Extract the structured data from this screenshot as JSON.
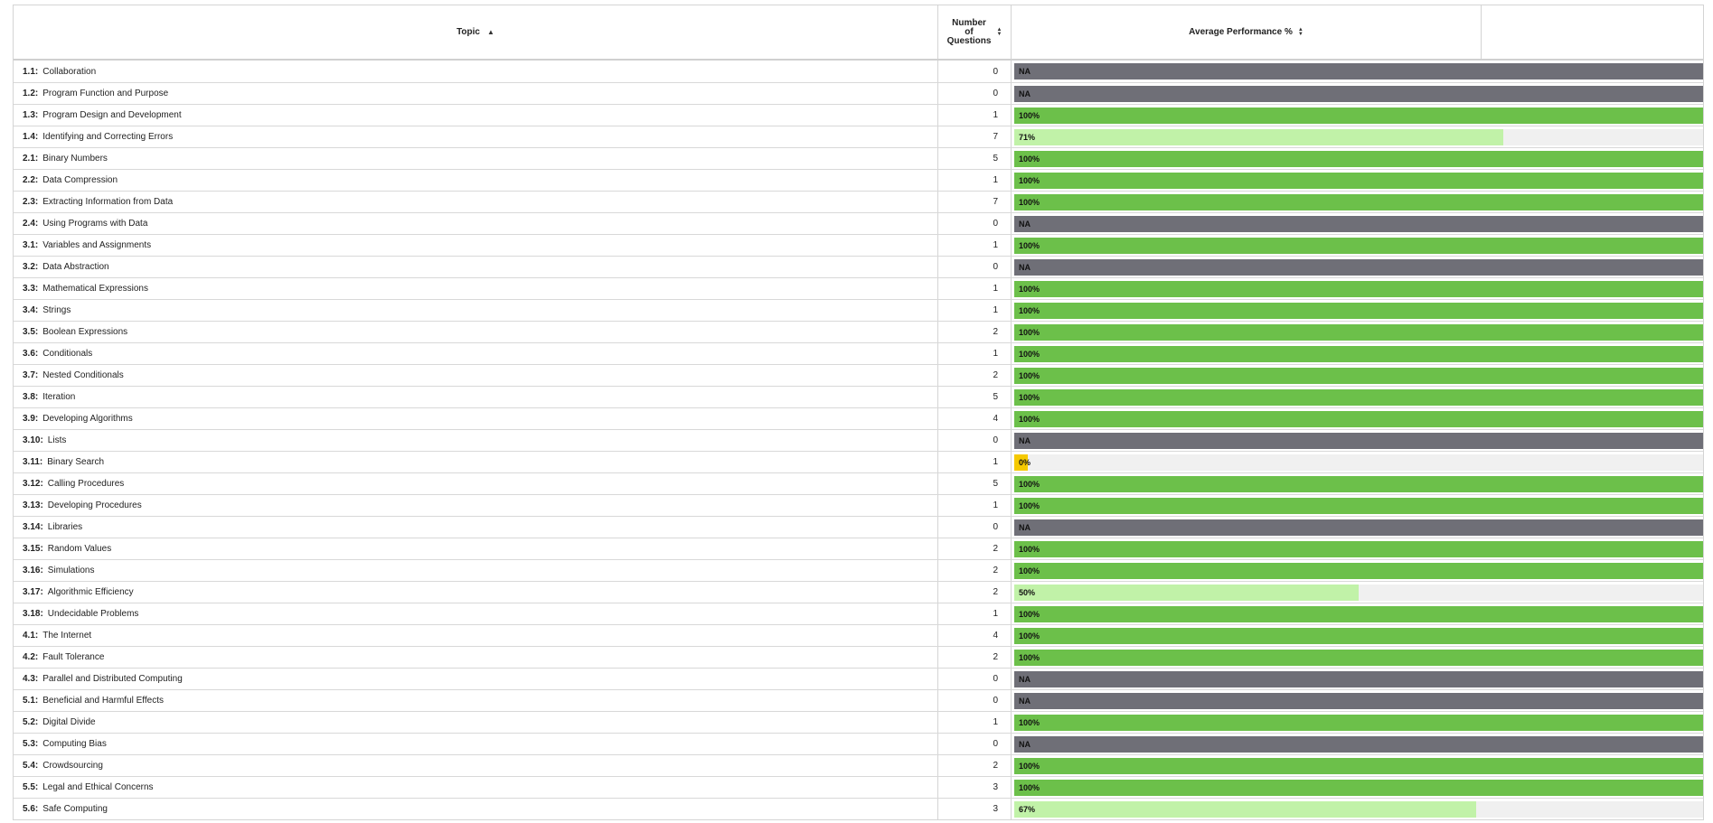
{
  "header": {
    "topic": "Topic",
    "number_of_questions": [
      "Number",
      "of",
      "Questions"
    ],
    "average_performance": "Average Performance %"
  },
  "colors": {
    "full": "#6cc04a",
    "partial": "#c1f2a8",
    "zero": "#f5c900",
    "na": "#6f6f77",
    "track": "#f0f0f0"
  },
  "rows": [
    {
      "code": "1.1:",
      "name": "Collaboration",
      "count": "0",
      "perf": "NA",
      "pct": null
    },
    {
      "code": "1.2:",
      "name": "Program Function and Purpose",
      "count": "0",
      "perf": "NA",
      "pct": null
    },
    {
      "code": "1.3:",
      "name": "Program Design and Development",
      "count": "1",
      "perf": "100%",
      "pct": 100
    },
    {
      "code": "1.4:",
      "name": "Identifying and Correcting Errors",
      "count": "7",
      "perf": "71%",
      "pct": 71
    },
    {
      "code": "2.1:",
      "name": "Binary Numbers",
      "count": "5",
      "perf": "100%",
      "pct": 100
    },
    {
      "code": "2.2:",
      "name": "Data Compression",
      "count": "1",
      "perf": "100%",
      "pct": 100
    },
    {
      "code": "2.3:",
      "name": "Extracting Information from Data",
      "count": "7",
      "perf": "100%",
      "pct": 100
    },
    {
      "code": "2.4:",
      "name": "Using Programs with Data",
      "count": "0",
      "perf": "NA",
      "pct": null
    },
    {
      "code": "3.1:",
      "name": "Variables and Assignments",
      "count": "1",
      "perf": "100%",
      "pct": 100
    },
    {
      "code": "3.2:",
      "name": "Data Abstraction",
      "count": "0",
      "perf": "NA",
      "pct": null
    },
    {
      "code": "3.3:",
      "name": "Mathematical Expressions",
      "count": "1",
      "perf": "100%",
      "pct": 100
    },
    {
      "code": "3.4:",
      "name": "Strings",
      "count": "1",
      "perf": "100%",
      "pct": 100
    },
    {
      "code": "3.5:",
      "name": "Boolean Expressions",
      "count": "2",
      "perf": "100%",
      "pct": 100
    },
    {
      "code": "3.6:",
      "name": "Conditionals",
      "count": "1",
      "perf": "100%",
      "pct": 100
    },
    {
      "code": "3.7:",
      "name": "Nested Conditionals",
      "count": "2",
      "perf": "100%",
      "pct": 100
    },
    {
      "code": "3.8:",
      "name": "Iteration",
      "count": "5",
      "perf": "100%",
      "pct": 100
    },
    {
      "code": "3.9:",
      "name": "Developing Algorithms",
      "count": "4",
      "perf": "100%",
      "pct": 100
    },
    {
      "code": "3.10:",
      "name": "Lists",
      "count": "0",
      "perf": "NA",
      "pct": null
    },
    {
      "code": "3.11:",
      "name": "Binary Search",
      "count": "1",
      "perf": "0%",
      "pct": 0
    },
    {
      "code": "3.12:",
      "name": "Calling Procedures",
      "count": "5",
      "perf": "100%",
      "pct": 100
    },
    {
      "code": "3.13:",
      "name": "Developing Procedures",
      "count": "1",
      "perf": "100%",
      "pct": 100
    },
    {
      "code": "3.14:",
      "name": "Libraries",
      "count": "0",
      "perf": "NA",
      "pct": null
    },
    {
      "code": "3.15:",
      "name": "Random Values",
      "count": "2",
      "perf": "100%",
      "pct": 100
    },
    {
      "code": "3.16:",
      "name": "Simulations",
      "count": "2",
      "perf": "100%",
      "pct": 100
    },
    {
      "code": "3.17:",
      "name": "Algorithmic Efficiency",
      "count": "2",
      "perf": "50%",
      "pct": 50
    },
    {
      "code": "3.18:",
      "name": "Undecidable Problems",
      "count": "1",
      "perf": "100%",
      "pct": 100
    },
    {
      "code": "4.1:",
      "name": "The Internet",
      "count": "4",
      "perf": "100%",
      "pct": 100
    },
    {
      "code": "4.2:",
      "name": "Fault Tolerance",
      "count": "2",
      "perf": "100%",
      "pct": 100
    },
    {
      "code": "4.3:",
      "name": "Parallel and Distributed Computing",
      "count": "0",
      "perf": "NA",
      "pct": null
    },
    {
      "code": "5.1:",
      "name": "Beneficial and Harmful Effects",
      "count": "0",
      "perf": "NA",
      "pct": null
    },
    {
      "code": "5.2:",
      "name": "Digital Divide",
      "count": "1",
      "perf": "100%",
      "pct": 100
    },
    {
      "code": "5.3:",
      "name": "Computing Bias",
      "count": "0",
      "perf": "NA",
      "pct": null
    },
    {
      "code": "5.4:",
      "name": "Crowdsourcing",
      "count": "2",
      "perf": "100%",
      "pct": 100
    },
    {
      "code": "5.5:",
      "name": "Legal and Ethical Concerns",
      "count": "3",
      "perf": "100%",
      "pct": 100
    },
    {
      "code": "5.6:",
      "name": "Safe Computing",
      "count": "3",
      "perf": "67%",
      "pct": 67
    }
  ]
}
